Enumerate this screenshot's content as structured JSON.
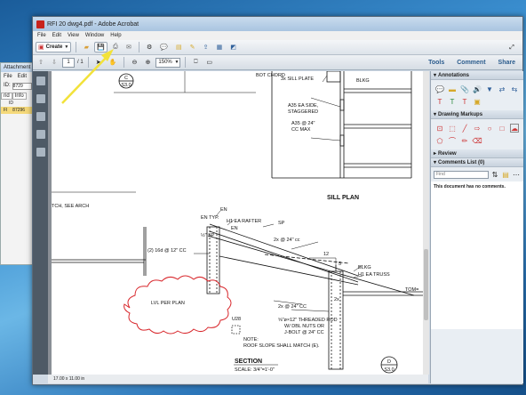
{
  "bg_window": {
    "title": "Attachment F",
    "menu": [
      "File",
      "Edit"
    ],
    "id_label": "ID:",
    "id_value": "8729",
    "tabs": [
      "rid",
      "Info"
    ],
    "row_header": [
      "",
      "ID"
    ],
    "row_value": [
      "Fl",
      "87296"
    ]
  },
  "window": {
    "title": "RFI 20 dwg4.pdf - Adobe Acrobat"
  },
  "menu": [
    "File",
    "Edit",
    "View",
    "Window",
    "Help"
  ],
  "toolbar": {
    "create_label": "Create",
    "page_current": "1",
    "page_total": "/ 1",
    "zoom": "150%",
    "tabs": [
      "Tools",
      "Comment",
      "Share"
    ]
  },
  "status": {
    "page_size": "17.00 x 11.00 in"
  },
  "right_pane": {
    "annotations": "Annotations",
    "drawing_markups": "Drawing Markups",
    "review": "Review",
    "comments_list": "Comments List (0)",
    "find_placeholder": "Find",
    "no_comments": "This document has no comments."
  },
  "drawing": {
    "top_marker_letter": "C",
    "top_marker_sheet": "S3.0",
    "sill_plate": "3x SILL PLATE",
    "blkg_top": "BLKG",
    "a35_1": "A35 EA SIDE,",
    "a35_2": "STAGGERED",
    "a35_3": "A35 @ 24\"",
    "a35_4": "CC MAX",
    "sill_plan": "SILL PLAN",
    "see_arch": "TCH, SEE ARCH",
    "en_typ": "EN TYP.",
    "en_1": "EN",
    "en_2": "EN",
    "h1_rafter": "H1 EA RAFTER",
    "sp": "SP",
    "sp_half": "½\" SP",
    "sixteen_d": "(2) 16d @ 12\" CC",
    "two_x_1": "2x @ 24\" cc",
    "twelve": "12",
    "five": "5",
    "blkg_2": "BLKG",
    "h1_truss": "H1 EA TRUSS",
    "tom": "TOM=",
    "lvl": "LVL PER PLAN",
    "two_x_2": "2x @ 24\" CC",
    "two_x_3": "2x",
    "u28": "U28",
    "rod_1": "⅝\"ø×12\" THREADED ROD",
    "rod_2": "W/ DBL NUTS OR",
    "rod_3": "J-BOLT @ 24\" CC",
    "note_1": "NOTE:",
    "note_2": "ROOF SLOPE SHALL MATCH (E).",
    "section": "SECTION",
    "scale": "SCALE:  3/4\"=1'-0\"",
    "bot_marker_letter": "D",
    "bot_marker_sheet": "S3.0",
    "top_partial": "BOT CHORD"
  },
  "colors": {
    "cloud": "#d8262b",
    "arrow": "#f2e23a",
    "tab_text": "#2a5b8c"
  }
}
